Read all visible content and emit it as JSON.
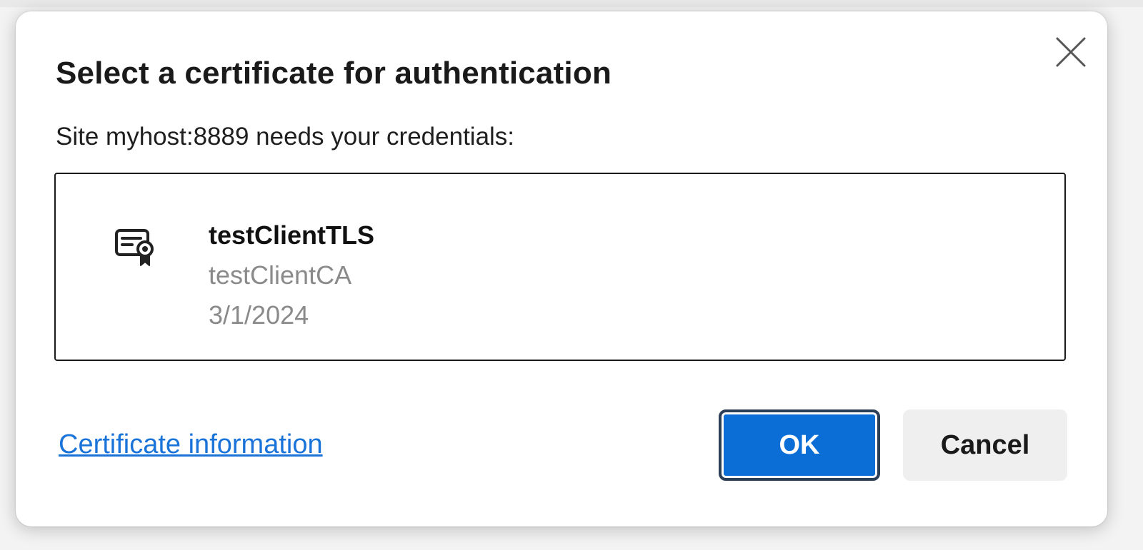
{
  "dialog": {
    "title": "Select a certificate for authentication",
    "subtitle": "Site myhost:8889 needs your credentials:",
    "close_icon": "close-icon",
    "certificates": [
      {
        "icon": "certificate-icon",
        "name": "testClientTLS",
        "issuer": "testClientCA",
        "date": "3/1/2024"
      }
    ],
    "info_link": "Certificate information",
    "ok_label": "OK",
    "cancel_label": "Cancel"
  },
  "colors": {
    "primary": "#0a6ed6",
    "link": "#1a73d9",
    "muted_text": "#8a8a8a",
    "cancel_bg": "#efefef"
  }
}
